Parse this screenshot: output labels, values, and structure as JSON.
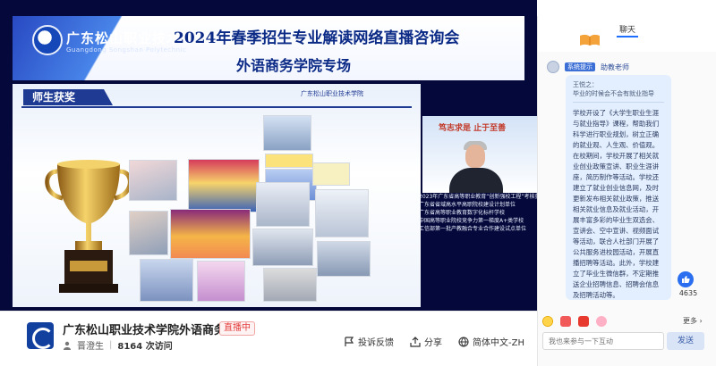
{
  "video": {
    "school_name": "广东松山职业技术学院",
    "school_name_en": "Guangdong Songshan Polytechnic",
    "banner_title": "2024年春季招生专业解读网络直播咨询会",
    "banner_subtitle": "外语商务学院专场",
    "slide": {
      "section_tag": "师生获奖",
      "school_label": "广东松山职业技术学院"
    },
    "speaker_backdrop": {
      "motto": "笃志求是 止于至善"
    },
    "awards": [
      "2023年广东省高等职业教育“创新强校工程”考核获评A类第8名",
      "广东省省域高水平高职院校建设计划单位",
      "广东省高等职业教育数字化标杆学校",
      "中国高等职业院校竞争力第一梯度A+类学校",
      "工信部第一批产教融合专业合作建设试点单位"
    ]
  },
  "infobar": {
    "channel_title": "广东松山职业技术学院外语商务学院",
    "live_status": "直播中",
    "host": "晋澄生",
    "visits": "8164 次访问",
    "actions": [
      {
        "label": "投诉反馈",
        "icon": "report-icon"
      },
      {
        "label": "分享",
        "icon": "share-icon"
      },
      {
        "label": "简体中文-ZH",
        "icon": "globe-icon"
      }
    ]
  },
  "chat": {
    "tab": "聊天",
    "message_user": "系统提示",
    "message_badge": "助教老师",
    "quote_name": "王悦之：",
    "quote_text": "毕业的时候会不会有就业指导",
    "answer": "学校开设了《大学生职业生涯与就业指导》课程，帮助我们科学进行职业规划，树立正确的就业观、人生观、价值观。在校期间，学校开展了相关就业创业政策宣讲、职业生涯讲座，简历制作等活动。学校还建立了就业创业信息网，及时更新发布相关就业政策，推送相关就业信息及就业活动，开展丰富多彩的毕业生双选会、宣讲会、空中宣讲、视频面试等活动，联合人社部门开展了公共服务进校园活动，开展直播招聘等活动。此外，学校建立了毕业生微信群，不定期推送企业招聘信息、招聘会信息及招聘活动等。",
    "likes": "4635",
    "more_label": "更多 ›",
    "input_placeholder": "我也来参与一下互动",
    "send_label": "发送"
  }
}
